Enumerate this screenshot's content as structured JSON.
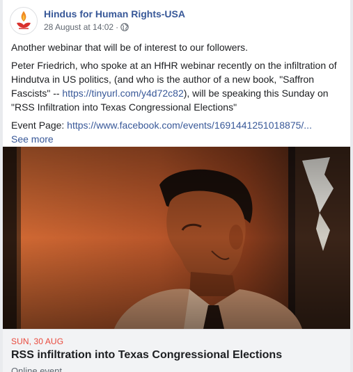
{
  "header": {
    "page_name": "Hindus for Human Rights-USA",
    "timestamp": "28 August at 14:02",
    "separator": "·"
  },
  "post": {
    "paragraph1": "Another webinar that will be of interest to our followers.",
    "paragraph2_a": "Peter Friedrich, who spoke at an HfHR webinar recently on the infiltration of Hindutva in US politics, (and who is the author of a new book, \"Saffron Fascists\" -- ",
    "paragraph2_link": "https://tinyurl.com/y4d72c82",
    "paragraph2_b": "), will be speaking this Sunday on \"RSS Infiltration into Texas Congressional Elections\"",
    "event_page_label": "Event Page: ",
    "event_page_link": "https://www.facebook.com/events/1691441251018875/...",
    "see_more": "See more"
  },
  "event": {
    "date": "SUN, 30 AUG",
    "title": "RSS infiltration into Texas Congressional Elections",
    "subtitle": "Online event"
  },
  "icons": {
    "avatar": "flame-lotus-logo",
    "audience": "globe-icon"
  },
  "colors": {
    "link": "#385898",
    "event_date": "#e9493c",
    "image_tint": "#c8622c"
  }
}
